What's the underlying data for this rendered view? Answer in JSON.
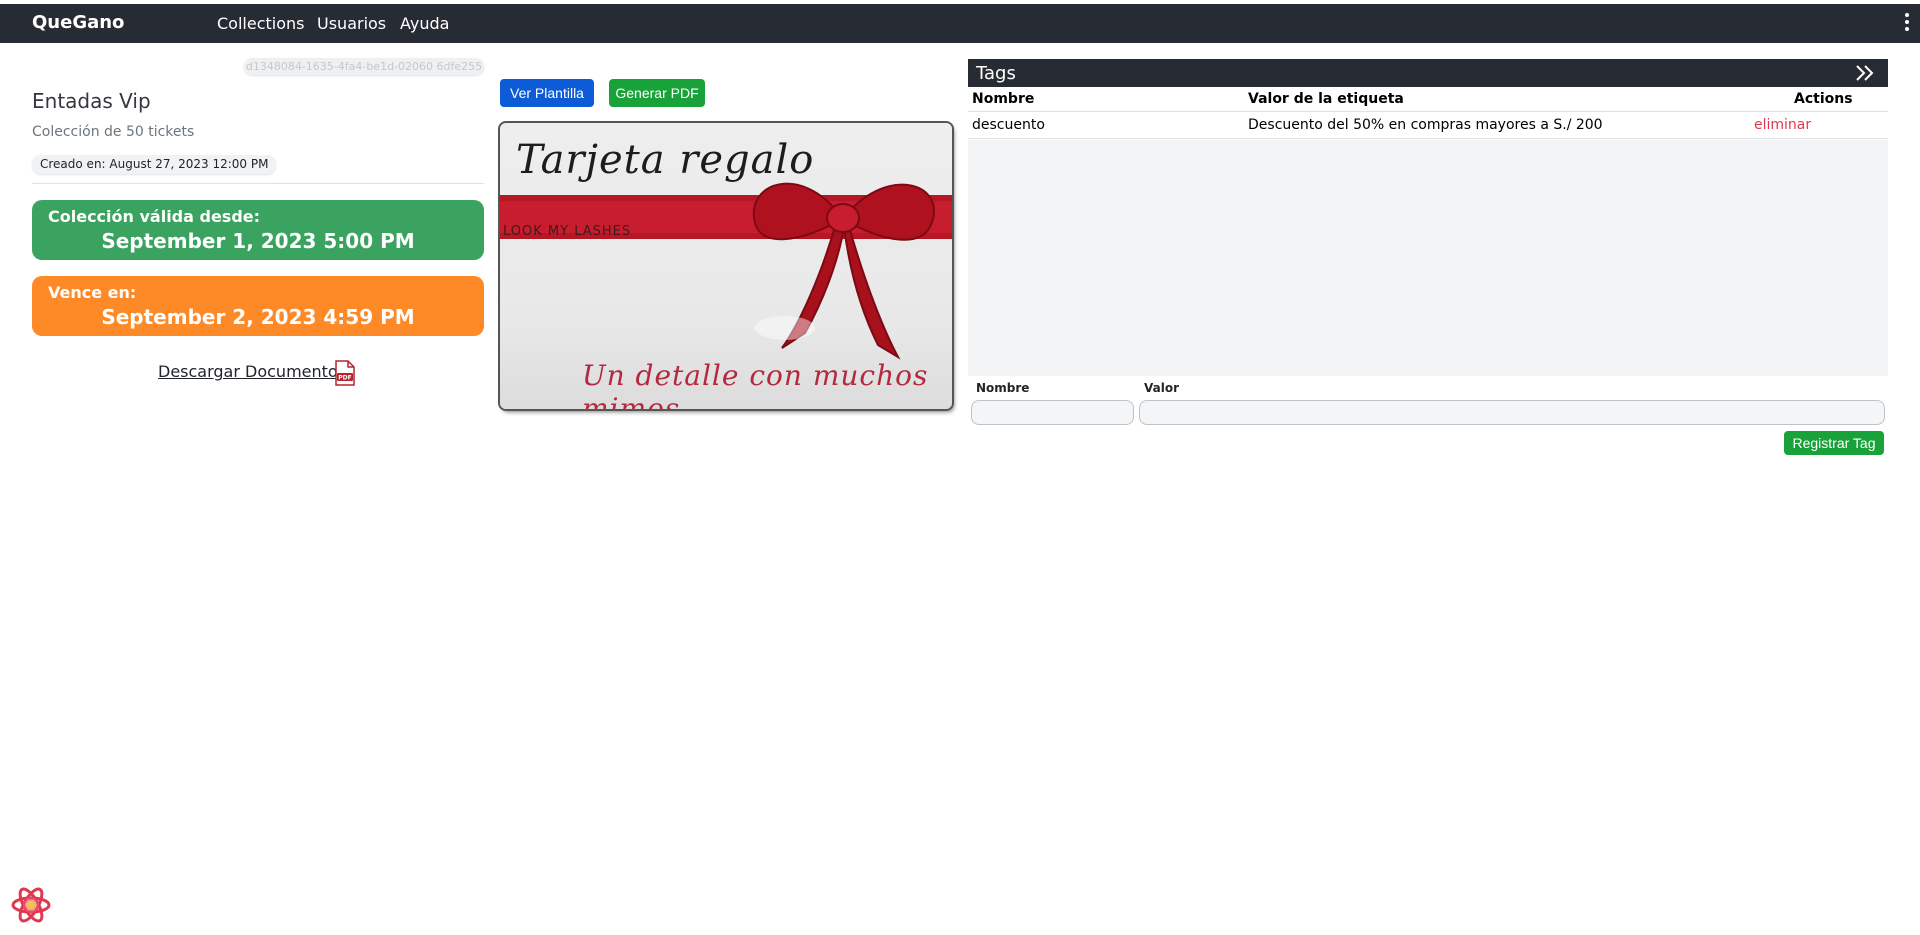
{
  "navbar": {
    "brand": "QueGano",
    "links": [
      "Collections",
      "Usuarios",
      "Ayuda"
    ]
  },
  "collection": {
    "id": "d1348084-1635-4fa4-be1d-02060 6dfe255",
    "title": "Entadas Vip",
    "subtitle": "Colección de 50 tickets",
    "created": "Creado en: August 27, 2023 12:00 PM",
    "valid_from_label": "Colección válida desde:",
    "valid_from": "September 1, 2023 5:00 PM",
    "expires_label": "Vence en:",
    "expires": "September 2, 2023 4:59 PM",
    "download_label": "Descargar Documento"
  },
  "template": {
    "view_button": "Ver Plantilla",
    "pdf_button": "Generar PDF",
    "card": {
      "title": "Tarjeta regalo",
      "brand": "LOOK MY LASHES",
      "slogan": "Un detalle con muchos mimos"
    }
  },
  "tags": {
    "title": "Tags",
    "columns": [
      "Nombre",
      "Valor de la etiqueta",
      "Actions"
    ],
    "rows": [
      {
        "name": "descuento",
        "value": "Descuento del 50% en compras mayores a S./ 200",
        "action": "eliminar"
      }
    ],
    "form": {
      "name_label": "Nombre",
      "value_label": "Valor",
      "name_value": "",
      "value_value": "",
      "submit": "Registrar Tag"
    }
  },
  "colors": {
    "navbar": "#272b33",
    "valid_card": "#3aa35f",
    "expires_card": "#fd8a26",
    "primary_button": "#0d5bd7",
    "success_button": "#19a23a",
    "danger_link": "#e0384f"
  },
  "icons": {
    "menu": "kebab-menu-icon",
    "pdf": "pdf-file-icon",
    "collapse": "double-chevron-right-icon",
    "devtools": "react-devtools-icon"
  }
}
